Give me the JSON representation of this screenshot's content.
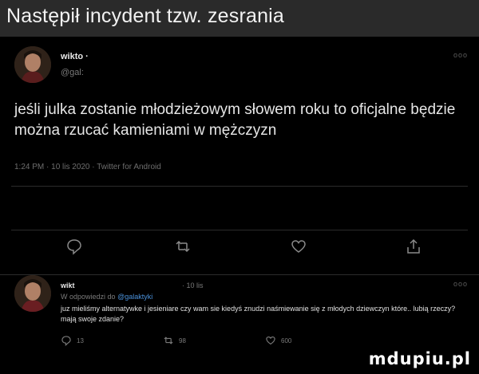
{
  "caption": "Następił incydent tzw. zesrania",
  "main_tweet": {
    "display_name": "wikto ·",
    "handle": "@gal:",
    "more": "ooo",
    "text": "jeśli julka zostanie młodzieżowym słowem roku to oficjalne będzie można rzucać kamieniami w mężczyzn",
    "meta": "1:24 PM · 10 lis 2020 · Twitter for Android",
    "actions": [
      "comment-icon",
      "retweet-icon",
      "like-icon",
      "share-icon"
    ]
  },
  "reply_tweet": {
    "display_name": "wikt",
    "time": "· 10 lis",
    "more": "ooo",
    "reply_prefix": "W odpowiedzi do",
    "mention": "@galaktyki",
    "text": "juz mieliśmy alternatywke i jesieniare czy wam sie kiedyś znudzi naśmiewanie się z młodych dziewczyn które.. lubią rzeczy? mają swoje zdanie?",
    "counts": {
      "comments": "13",
      "retweets": "98",
      "likes": "600"
    }
  },
  "watermark": "mdupiu.pl",
  "colors": {
    "background": "#000000",
    "caption_bar": "#2a2a2a",
    "mention": "#4a90d9"
  }
}
